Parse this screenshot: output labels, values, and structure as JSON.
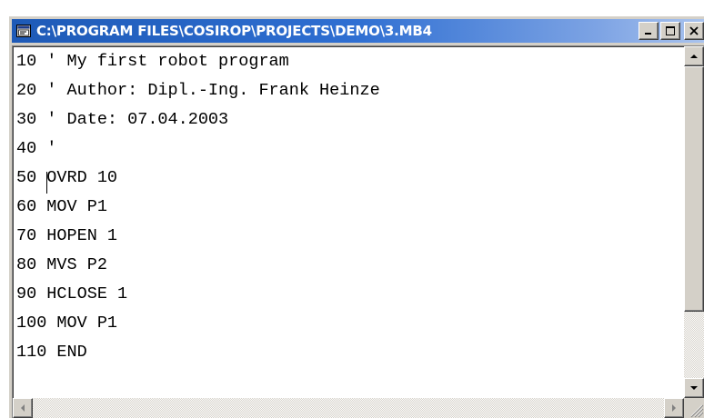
{
  "window": {
    "title": "C:\\PROGRAM FILES\\COSIROP\\PROJECTS\\DEMO\\3.MB4"
  },
  "editor": {
    "lines": [
      "10 ' My first robot program",
      "20 ' Author: Dipl.-Ing. Frank Heinze",
      "30 ' Date: 07.04.2003",
      "40 '",
      "50 OVRD 10",
      "60 MOV P1",
      "70 HOPEN 1",
      "80 MVS P2",
      "90 HCLOSE 1",
      "100 MOV P1",
      "110 END"
    ]
  },
  "colors": {
    "titlebar_start": "#1e5ab7",
    "titlebar_end": "#a9c3ee",
    "face": "#d4d0c8"
  },
  "icons": {
    "app": "editor-app-icon",
    "minimize": "minimize-icon",
    "maximize": "maximize-icon",
    "close": "close-icon",
    "scroll_up": "arrow-up-icon",
    "scroll_down": "arrow-down-icon",
    "scroll_left": "arrow-left-icon",
    "scroll_right": "arrow-right-icon"
  }
}
